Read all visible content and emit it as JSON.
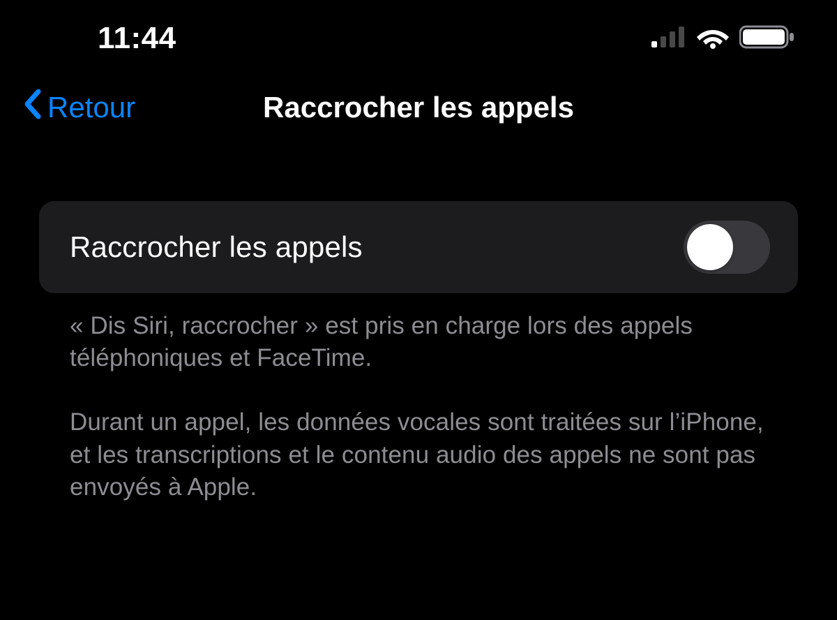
{
  "status": {
    "time": "11:44"
  },
  "nav": {
    "back": "Retour",
    "title": "Raccrocher les appels"
  },
  "setting": {
    "label": "Raccrocher les appels",
    "enabled": false
  },
  "footer": {
    "p1": "« Dis Siri, raccrocher » est pris en charge lors des appels téléphoniques et FaceTime.",
    "p2": "Durant un appel, les données vocales sont traitées sur l’iPhone, et les transcriptions et le contenu audio des appels ne sont pas envoyés à Apple."
  }
}
